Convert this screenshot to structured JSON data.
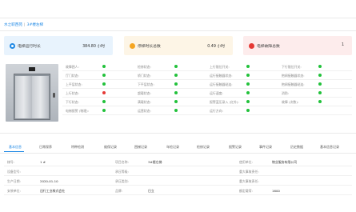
{
  "breadcrumb": {
    "parent": "水之职西苑",
    "separator": "|",
    "current": "3#楼左梯"
  },
  "summary": [
    {
      "label": "电梯运行时长",
      "value": "384.80 小时",
      "color": "#1e88e5"
    },
    {
      "label": "停梯时长总数",
      "value": "0.49 小时",
      "color": "#f5a623"
    },
    {
      "label": "电梯故障总数",
      "value": "1",
      "color": "#e53935"
    }
  ],
  "status_rows": [
    [
      {
        "label": "故障困人:",
        "state": "green"
      },
      {
        "label": "检修状态:",
        "state": "green"
      },
      {
        "label": "上行限位开关:",
        "state": "green"
      },
      {
        "label": "下行限位开关:",
        "state": "green"
      }
    ],
    [
      {
        "label": "厅门状态:",
        "state": "green"
      },
      {
        "label": "轿门状态:",
        "state": "green"
      },
      {
        "label": "运行接触器状态:",
        "state": "green"
      },
      {
        "label": "抱闸接触器状态:",
        "state": "green"
      }
    ],
    [
      {
        "label": "上平层状态:",
        "state": "green"
      },
      {
        "label": "下平层状态:",
        "state": "green"
      },
      {
        "label": "运行接触器粘连:",
        "state": "green"
      },
      {
        "label": "抱闸接触器粘连:",
        "state": "green"
      }
    ],
    [
      {
        "label": "上行状态:",
        "state": "red"
      },
      {
        "label": "超载状态:",
        "state": "green"
      },
      {
        "label": "运行速度:",
        "state": "green"
      },
      {
        "label": "消防:",
        "state": "green"
      }
    ],
    [
      {
        "label": "下行状态:",
        "state": "green"
      },
      {
        "label": "满载状态:",
        "state": "green"
      },
      {
        "label": "报警蓝压录入 (红外):",
        "state": "green"
      },
      {
        "label": "故障 (次数):",
        "state": "green"
      }
    ],
    [
      {
        "label": "电梯报警 (物理):",
        "state": "green"
      },
      {
        "label": "运营状态:",
        "state": "green"
      },
      {
        "label": "运行方向:",
        "state": "green"
      }
    ]
  ],
  "tabs": [
    {
      "label": "基本信息",
      "active": true
    },
    {
      "label": "日常保养",
      "active": false
    },
    {
      "label": "特种检测",
      "active": false
    },
    {
      "label": "维保记录",
      "active": false
    },
    {
      "label": "困梯记录",
      "active": false
    },
    {
      "label": "年检记录",
      "active": false
    },
    {
      "label": "检修记录",
      "active": false
    },
    {
      "label": "报警记录",
      "active": false
    },
    {
      "label": "事件记录",
      "active": false
    },
    {
      "label": "历史数据",
      "active": false
    },
    {
      "label": "基本信息记录",
      "active": false
    }
  ],
  "info_rows": [
    [
      {
        "key": "梯号:",
        "value": "1 #"
      },
      {
        "key": "项目名称:",
        "value": "3#楼左梯"
      },
      {
        "key": "使用单位:",
        "value": "物业服务有限公司"
      }
    ],
    [
      {
        "key": "设备型号:",
        "value": ""
      },
      {
        "key": "承压等级:",
        "value": ""
      },
      {
        "key": "重大事故责任:",
        "value": ""
      }
    ],
    [
      {
        "key": "生产日期:",
        "value": "2020-01-10"
      },
      {
        "key": "承压类别:",
        "value": ""
      },
      {
        "key": "重大事故责任:",
        "value": ""
      }
    ],
    [
      {
        "key": "安装单位:",
        "value": "迅行工业株式会社"
      },
      {
        "key": "品牌:",
        "value": "日立"
      },
      {
        "key": "额定载荷:",
        "value": "1600"
      }
    ]
  ]
}
